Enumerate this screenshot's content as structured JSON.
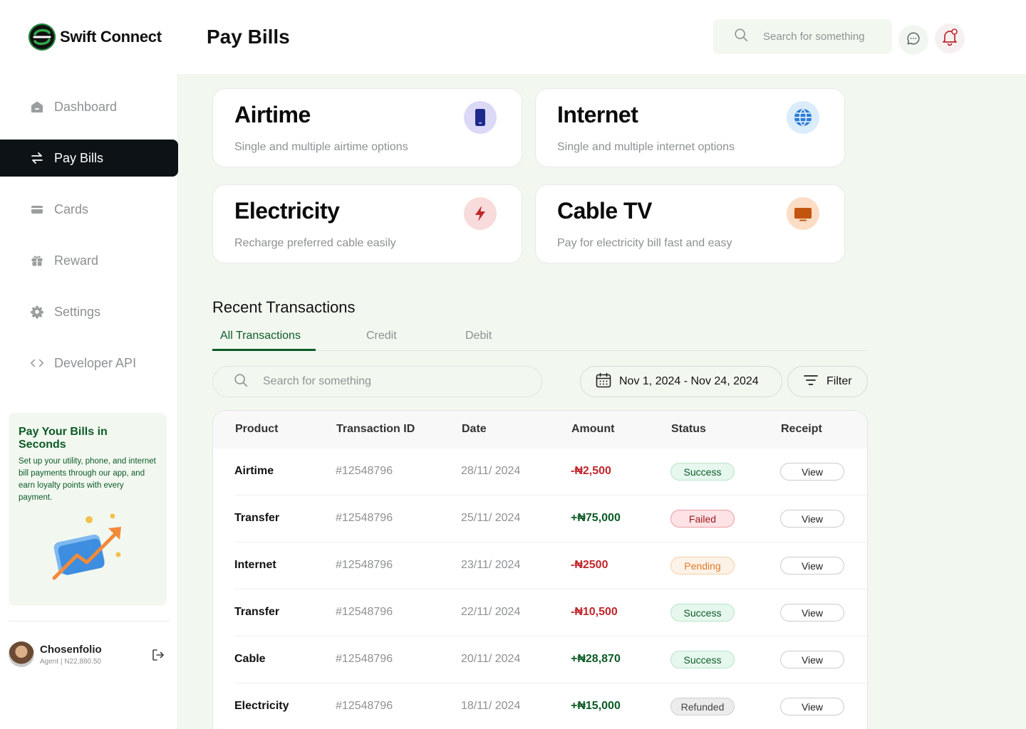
{
  "brand": {
    "name": "Swift Connect"
  },
  "header": {
    "title": "Pay Bills",
    "search_placeholder": "Search for something"
  },
  "sidebar": {
    "items": [
      {
        "label": "Dashboard",
        "icon": "home-icon",
        "active": false
      },
      {
        "label": "Pay Bills",
        "icon": "transfer-arrows-icon",
        "active": true
      },
      {
        "label": "Cards",
        "icon": "card-icon",
        "active": false
      },
      {
        "label": "Reward",
        "icon": "gift-icon",
        "active": false
      },
      {
        "label": "Settings",
        "icon": "gear-icon",
        "active": false
      },
      {
        "label": "Developer API",
        "icon": "code-icon",
        "active": false
      }
    ],
    "promo": {
      "title": "Pay Your Bills in Seconds",
      "text": "Set up your utility, phone, and internet bill payments through our app, and earn loyalty points with every payment."
    },
    "user": {
      "name": "Chosenfolio",
      "meta": "Agent | N22,880.50"
    }
  },
  "services": [
    {
      "title": "Airtime",
      "desc": "Single and multiple airtime options",
      "icon": "phone-icon",
      "icon_bg": "#dcd9f7",
      "icon_color": "#1e2a8c"
    },
    {
      "title": "Internet",
      "desc": "Single and multiple internet options",
      "icon": "globe-icon",
      "icon_bg": "#dbecfb",
      "icon_color": "#2b7bd6"
    },
    {
      "title": "Electricity",
      "desc": "Recharge preferred cable easily",
      "icon": "lightning-icon",
      "icon_bg": "#f8dcdc",
      "icon_color": "#c0262d"
    },
    {
      "title": "Cable TV",
      "desc": "Pay for electricity bill fast and easy",
      "icon": "tv-icon",
      "icon_bg": "#fbdcc4",
      "icon_color": "#c2560f"
    }
  ],
  "transactions": {
    "title": "Recent Transactions",
    "tabs": [
      "All Transactions",
      "Credit",
      "Debit"
    ],
    "active_tab": "All Transactions",
    "search_placeholder": "Search for something",
    "date_range": "Nov 1, 2024 - Nov 24, 2024",
    "filter_label": "Filter",
    "columns": [
      "Product",
      "Transaction ID",
      "Date",
      "Amount",
      "Status",
      "Receipt"
    ],
    "rows": [
      {
        "product": "Airtime",
        "id": "#12548796",
        "date": "28/11/ 2024",
        "amount": "-₦2,500",
        "direction": "debit",
        "status": "Success",
        "receipt": "View"
      },
      {
        "product": "Transfer",
        "id": "#12548796",
        "date": "25/11/ 2024",
        "amount": "+₦75,000",
        "direction": "credit",
        "status": "Failed",
        "receipt": "View"
      },
      {
        "product": "Internet",
        "id": "#12548796",
        "date": "23/11/ 2024",
        "amount": "-₦2500",
        "direction": "debit",
        "status": "Pending",
        "receipt": "View"
      },
      {
        "product": "Transfer",
        "id": "#12548796",
        "date": "22/11/ 2024",
        "amount": "-₦10,500",
        "direction": "debit",
        "status": "Success",
        "receipt": "View"
      },
      {
        "product": "Cable",
        "id": "#12548796",
        "date": "20/11/ 2024",
        "amount": "+₦28,870",
        "direction": "credit",
        "status": "Success",
        "receipt": "View"
      },
      {
        "product": "Electricity",
        "id": "#12548796",
        "date": "18/11/ 2024",
        "amount": "+₦15,000",
        "direction": "credit",
        "status": "Refunded",
        "receipt": "View"
      }
    ]
  },
  "colors": {
    "brand_green": "#0d5a27",
    "background_tint": "#f2f8f0",
    "active_nav": "#0c1215",
    "debit": "#c0262d",
    "credit": "#0d5a27"
  }
}
